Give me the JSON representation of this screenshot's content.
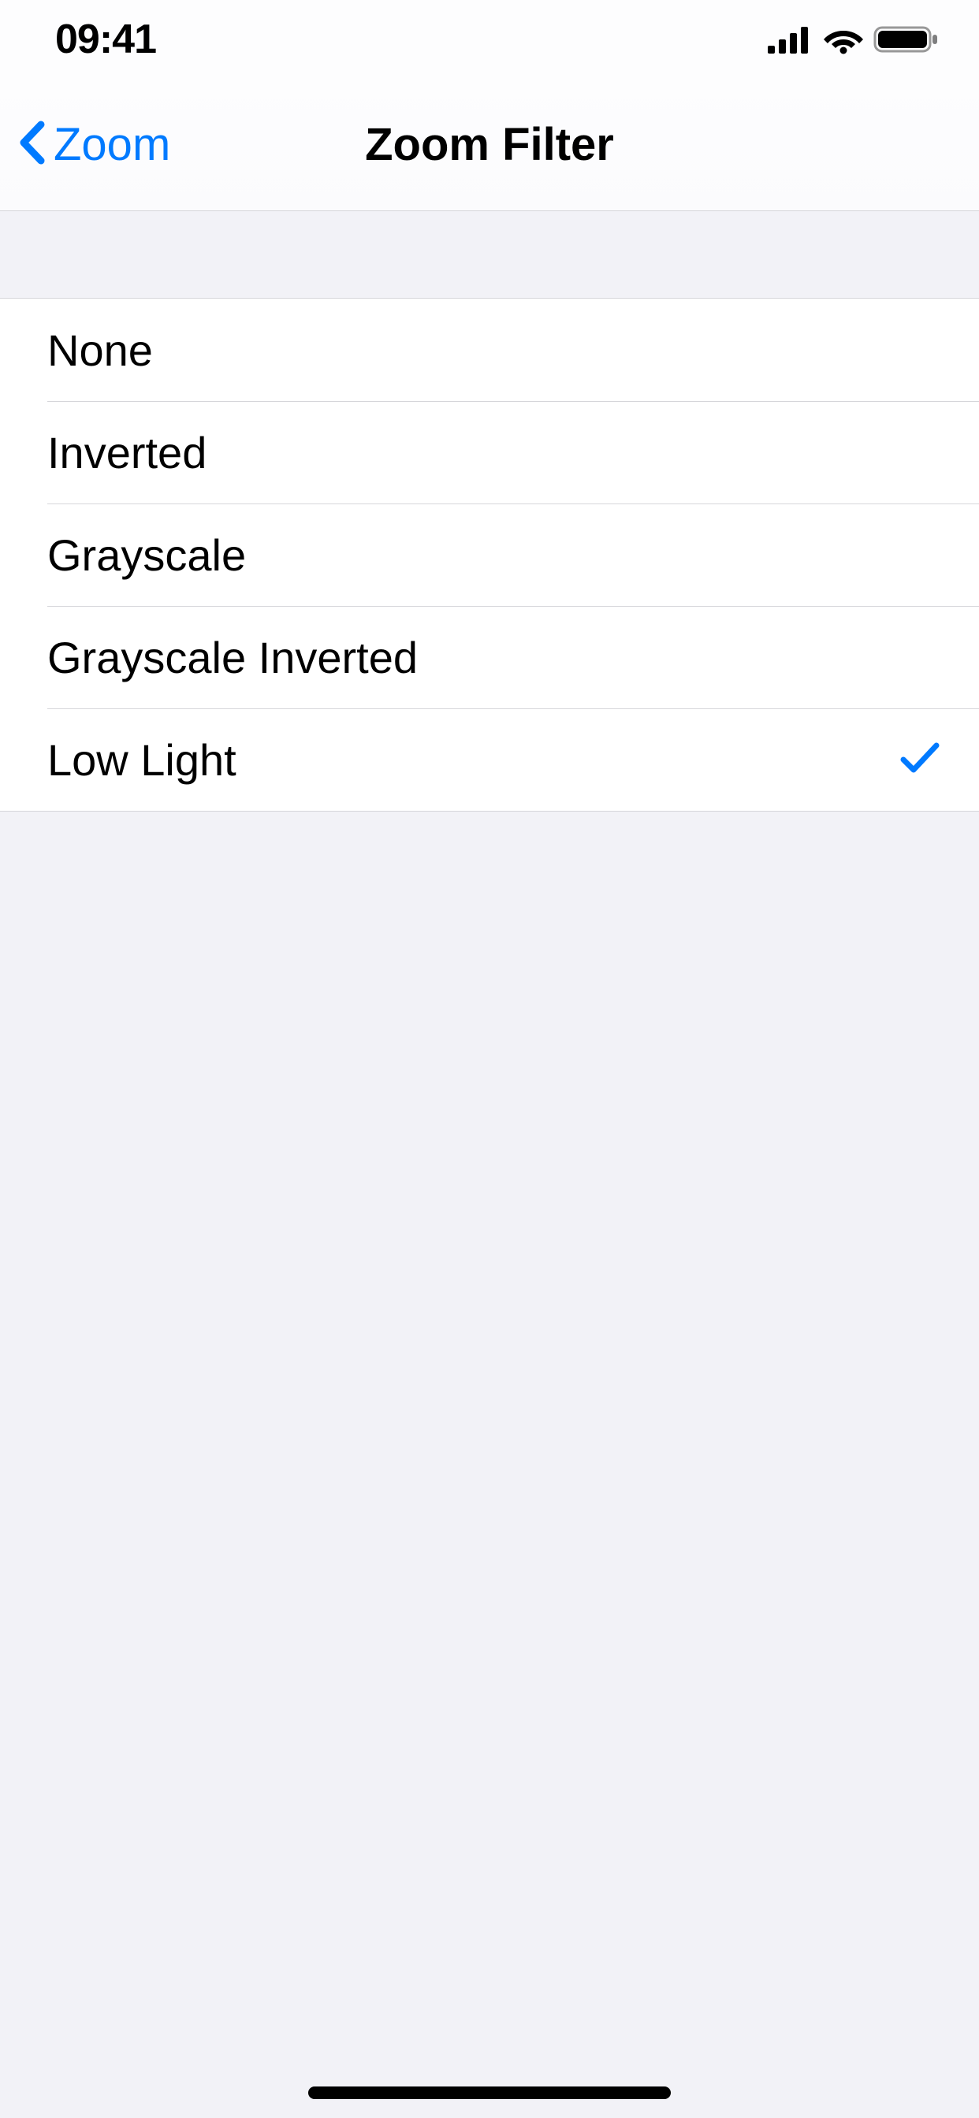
{
  "status_bar": {
    "time": "09:41"
  },
  "nav": {
    "back_label": "Zoom",
    "title": "Zoom Filter"
  },
  "filters": [
    {
      "label": "None",
      "selected": false
    },
    {
      "label": "Inverted",
      "selected": false
    },
    {
      "label": "Grayscale",
      "selected": false
    },
    {
      "label": "Grayscale Inverted",
      "selected": false
    },
    {
      "label": "Low Light",
      "selected": true
    }
  ],
  "colors": {
    "accent": "#007aff",
    "background": "#f2f2f7",
    "separator": "#d6d6da"
  }
}
